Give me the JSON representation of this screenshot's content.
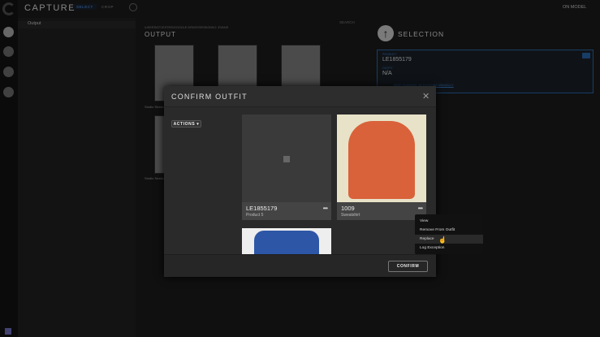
{
  "app": {
    "title": "CAPTURE",
    "tools": [
      "SELECT",
      "CROP"
    ],
    "mode": "ON MODEL"
  },
  "sidebar": {
    "items": [
      {
        "label": "Output"
      }
    ]
  },
  "main": {
    "path": "/USERS/DTJESTER/GOOGLE DRIVE/SESSIONS/J. EVANS",
    "heading": "OUTPUT",
    "search_placeholder": "SEARCH",
    "thumb_captions": [
      "Studio Session",
      "Studio Session"
    ]
  },
  "selection": {
    "title": "SELECTION",
    "product_label": "PRODUCT",
    "product": "LE1855179",
    "outfit_label": "OUTFIT",
    "outfit": "N/A",
    "keep_scanning": "KEEP SCANNING OR ENTERING MANUALLY"
  },
  "modal": {
    "title": "CONFIRM OUTFIT",
    "actions_label": "ACTIONS",
    "confirm_label": "CONFIRM",
    "cards": [
      {
        "id": "LE1855179",
        "name": "Product 5"
      },
      {
        "id": "1009",
        "name": "Sweatshirt"
      }
    ]
  },
  "context_menu": {
    "items": [
      "View",
      "Remove From Outfit",
      "Replace",
      "Log Exception"
    ],
    "highlighted": "Replace"
  },
  "colors": {
    "accent": "#2a6fb8",
    "sweatshirt": "#d9623a",
    "denim": "#2e56a6"
  }
}
